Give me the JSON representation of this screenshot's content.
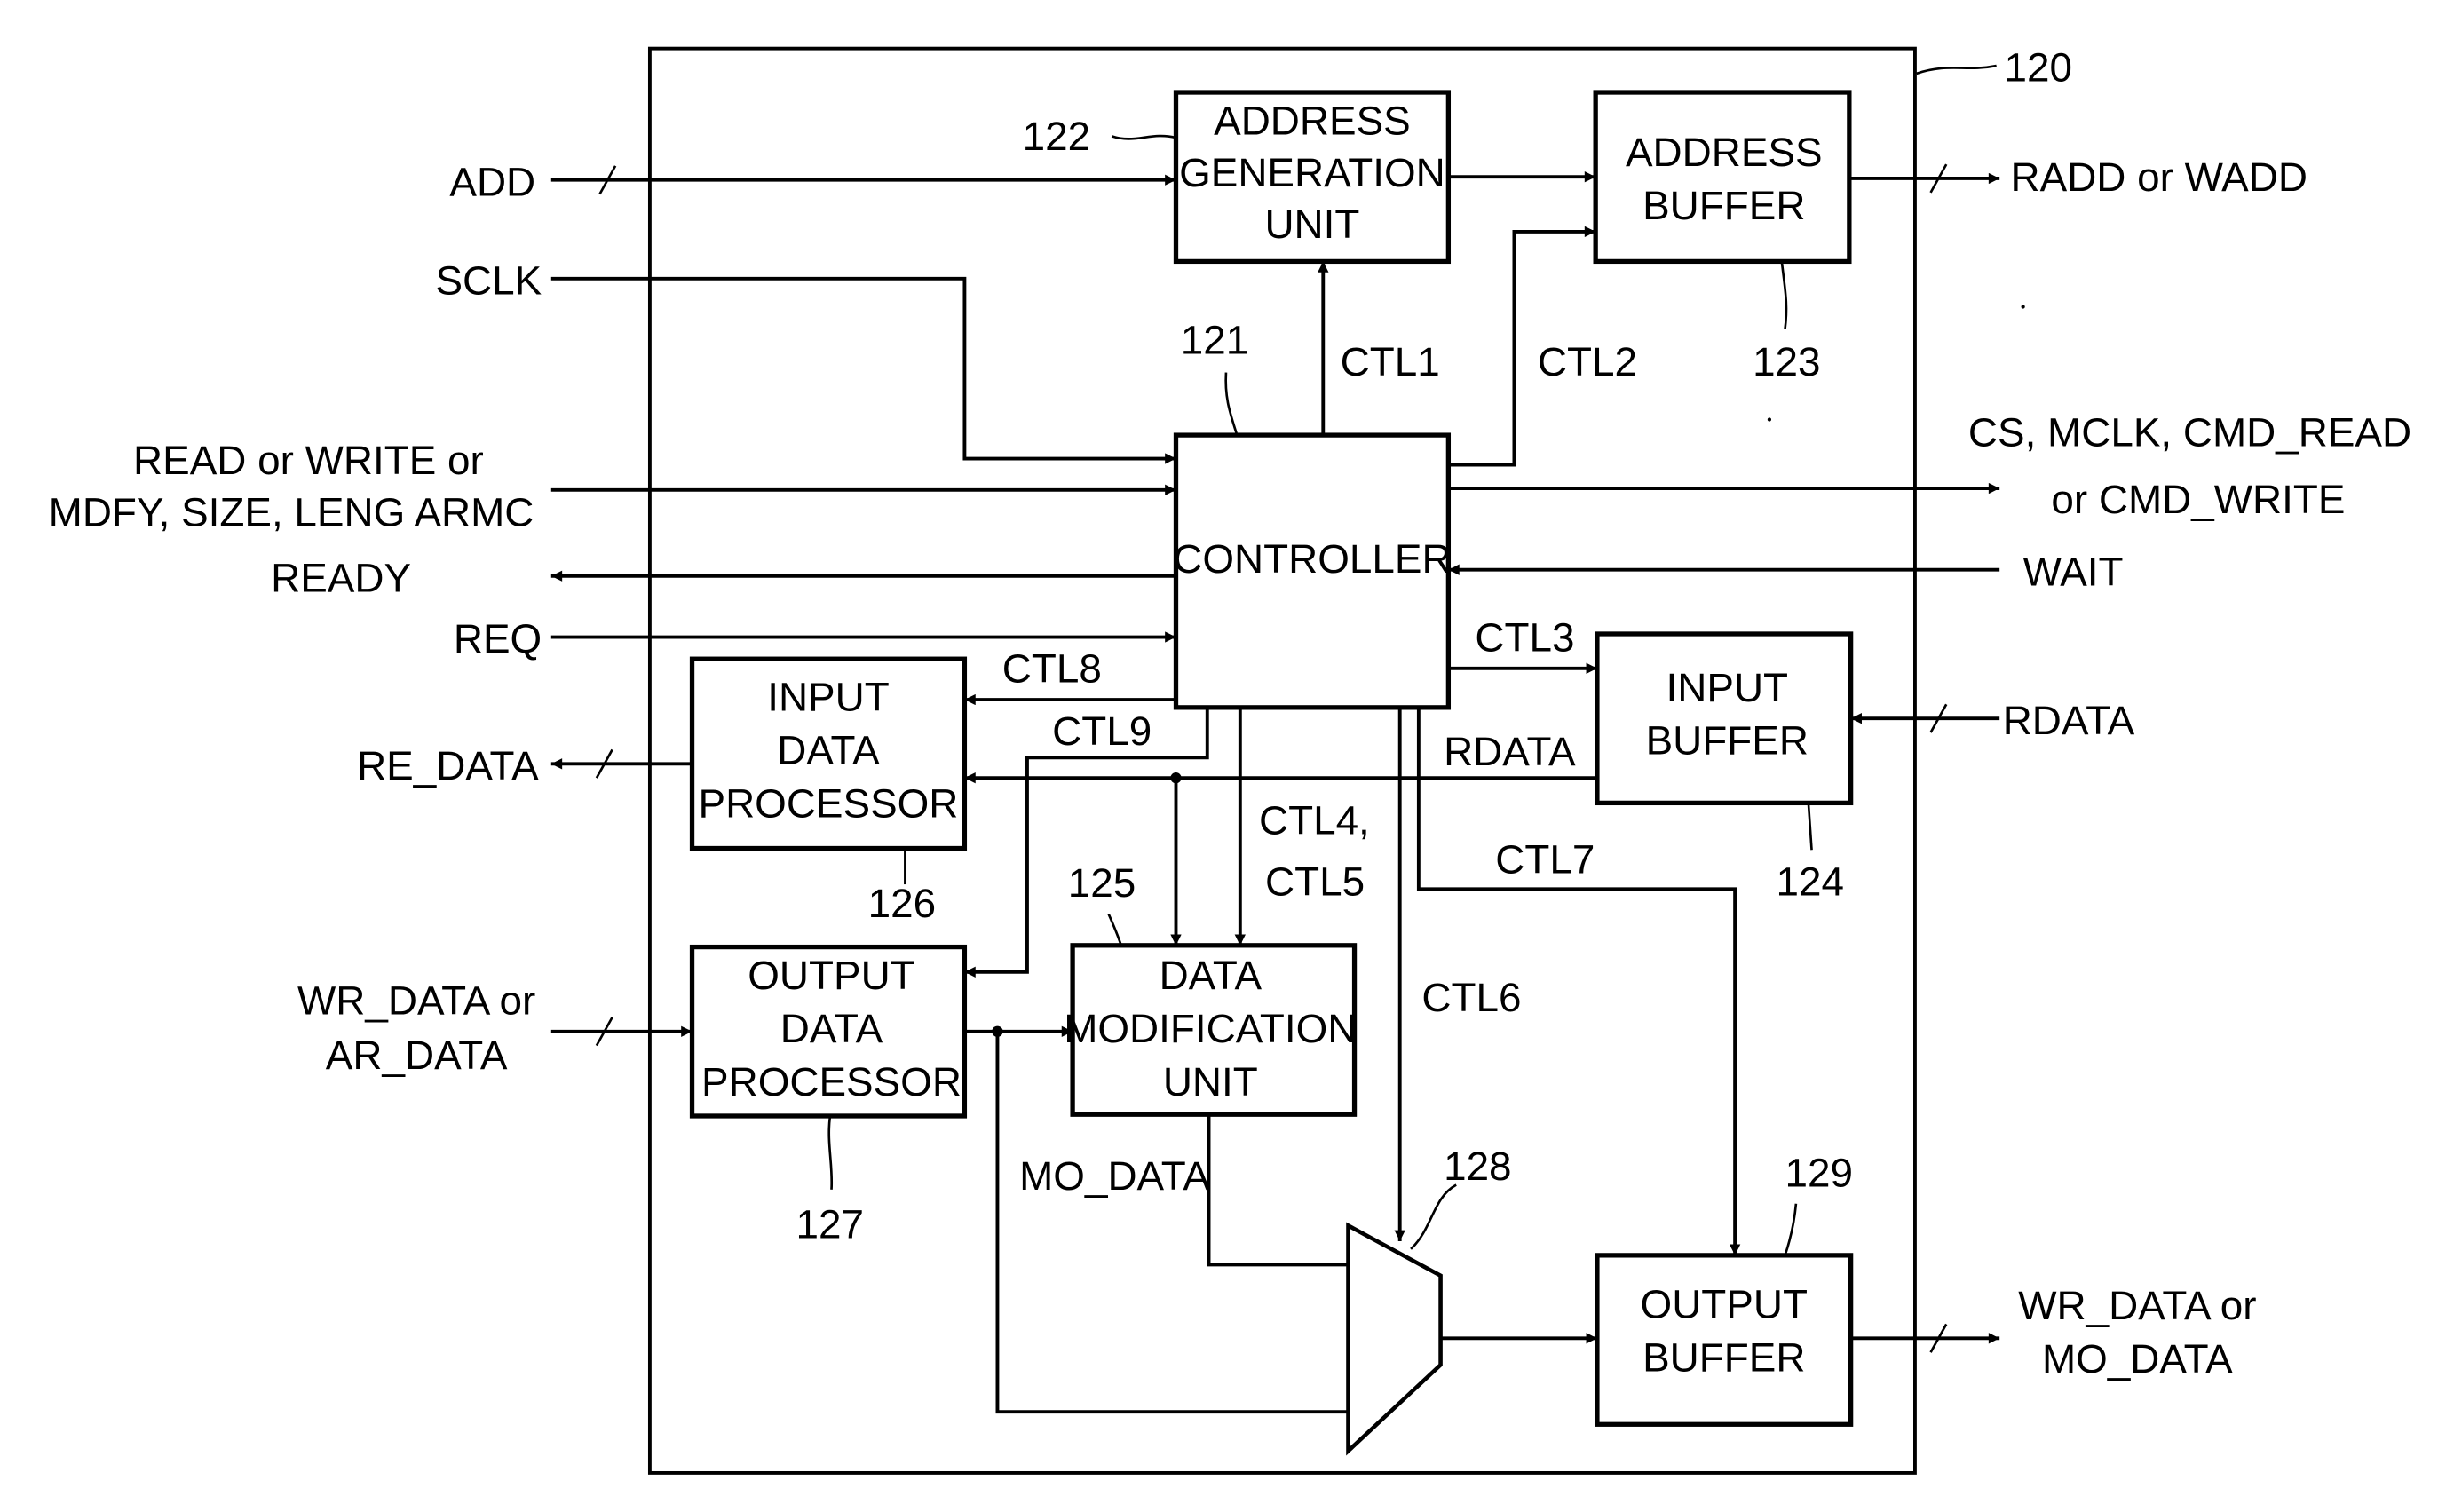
{
  "diagram": {
    "frame_ref": "120",
    "blocks": {
      "controller": {
        "ref": "121",
        "lines": [
          "CONTROLLER"
        ]
      },
      "address_generation_unit": {
        "ref": "122",
        "lines": [
          "ADDRESS",
          "GENERATION",
          "UNIT"
        ]
      },
      "address_buffer": {
        "ref": "123",
        "lines": [
          "ADDRESS",
          "BUFFER"
        ]
      },
      "input_buffer": {
        "ref": "124",
        "lines": [
          "INPUT",
          "BUFFER"
        ]
      },
      "data_modification_unit": {
        "ref": "125",
        "lines": [
          "DATA",
          "MODIFICATION",
          "UNIT"
        ]
      },
      "input_data_processor": {
        "ref": "126",
        "lines": [
          "INPUT",
          "DATA",
          "PROCESSOR"
        ]
      },
      "output_data_processor": {
        "ref": "127",
        "lines": [
          "OUTPUT",
          "DATA",
          "PROCESSOR"
        ]
      },
      "multiplexer": {
        "ref": "128"
      },
      "output_buffer": {
        "ref": "129",
        "lines": [
          "OUTPUT",
          "BUFFER"
        ]
      }
    },
    "external_signals": {
      "add": "ADD",
      "sclk": "SCLK",
      "read_write": [
        "READ or WRITE or",
        "MDFY, SIZE, LENG ARMC"
      ],
      "ready": "READY",
      "req": "REQ",
      "re_data": "RE_DATA",
      "wr_ar_data": [
        "WR_DATA or",
        "AR_DATA"
      ],
      "radd_wadd": "RADD or WADD",
      "cs_mclk": [
        "CS, MCLK, CMD_READ",
        "or CMD_WRITE"
      ],
      "wait": "WAIT",
      "rdata_in": "RDATA",
      "wr_mo_data": [
        "WR_DATA or",
        "MO_DATA"
      ]
    },
    "internal_signals": {
      "ctl1": "CTL1",
      "ctl2": "CTL2",
      "ctl3": "CTL3",
      "ctl4_5": [
        "CTL4,",
        "CTL5"
      ],
      "ctl6": "CTL6",
      "ctl7": "CTL7",
      "ctl8": "CTL8",
      "ctl9": "CTL9",
      "rdata_internal": "RDATA",
      "mo_data": "MO_DATA"
    }
  }
}
